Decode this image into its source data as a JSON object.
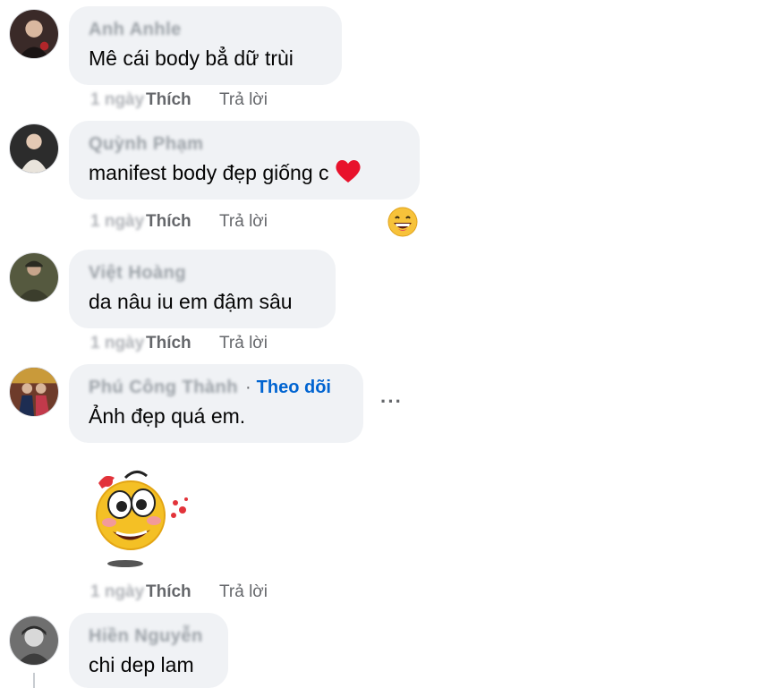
{
  "comments": [
    {
      "author": "Anh Anhle",
      "text": "Mê cái body bẳ dữ trùi",
      "time": "1 ngày",
      "like": "Thích",
      "reply": "Trả lời"
    },
    {
      "author": "Quỳnh Phạm",
      "text": "manifest body đẹp giống c",
      "time": "1 ngày",
      "like": "Thích",
      "reply": "Trả lời",
      "reaction_icon": "grinning-face-icon"
    },
    {
      "author": "Việt Hoàng",
      "text": "da nâu iu em đậm sâu",
      "time": "1 ngày",
      "like": "Thích",
      "reply": "Trả lời"
    },
    {
      "author": "Phú Công Thành",
      "follow": "Theo dõi",
      "separator": "·",
      "text": "Ảnh đẹp quá em.",
      "time": "1 ngày",
      "like": "Thích",
      "reply": "Trả lời",
      "more": "···",
      "sticker": "blushing-smiley-sticker"
    },
    {
      "author": "Hiền Nguyễn",
      "text": "chi dep lam"
    }
  ],
  "colors": {
    "bubble": "#f0f2f5",
    "link": "#0064d1",
    "muted": "#65676b"
  }
}
